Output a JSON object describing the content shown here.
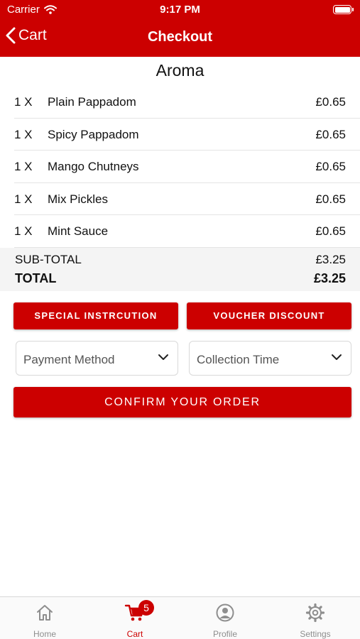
{
  "status_bar": {
    "carrier": "Carrier",
    "time": "9:17 PM"
  },
  "nav": {
    "back_label": "Cart",
    "title": "Checkout"
  },
  "restaurant_name": "Aroma",
  "items": [
    {
      "qty": "1 X",
      "name": "Plain Pappadom",
      "price": "£0.65"
    },
    {
      "qty": "1 X",
      "name": "Spicy Pappadom",
      "price": "£0.65"
    },
    {
      "qty": "1 X",
      "name": "Mango Chutneys",
      "price": "£0.65"
    },
    {
      "qty": "1 X",
      "name": "Mix Pickles",
      "price": "£0.65"
    },
    {
      "qty": "1 X",
      "name": "Mint Sauce",
      "price": "£0.65"
    }
  ],
  "totals": {
    "subtotal_label": "SUB-TOTAL",
    "subtotal_value": "£3.25",
    "total_label": "TOTAL",
    "total_value": "£3.25"
  },
  "actions": {
    "special_label": "SPECIAL INSTRCUTION",
    "voucher_label": "VOUCHER DISCOUNT",
    "payment_placeholder": "Payment Method",
    "collection_placeholder": "Collection Time",
    "confirm_label": "CONFIRM YOUR ORDER"
  },
  "tab_bar": {
    "tabs": [
      {
        "label": "Home",
        "icon": "home-icon"
      },
      {
        "label": "Cart",
        "icon": "cart-icon",
        "badge": "5",
        "active": true
      },
      {
        "label": "Profile",
        "icon": "profile-icon"
      },
      {
        "label": "Settings",
        "icon": "gear-icon"
      }
    ]
  },
  "colors": {
    "accent": "#cc0000",
    "inactive_tab": "#8e8e8e"
  }
}
